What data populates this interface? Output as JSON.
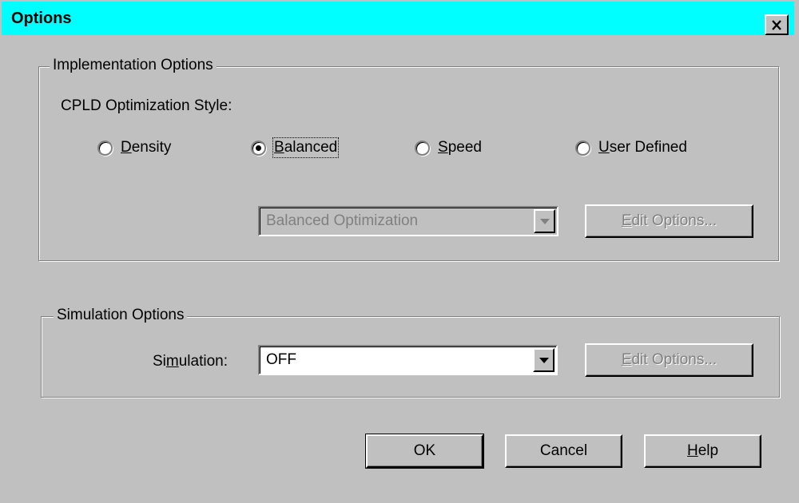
{
  "window": {
    "title": "Options",
    "close_icon": "close-x-icon"
  },
  "implementation": {
    "legend": "Implementation Options",
    "style_label": "CPLD Optimization Style:",
    "radios": [
      {
        "label": "Density",
        "mnemonic": "D",
        "rest": "ensity",
        "selected": false
      },
      {
        "label": "Balanced",
        "mnemonic": "B",
        "rest": "alanced",
        "selected": true
      },
      {
        "label": "Speed",
        "mnemonic": "S",
        "rest": "peed",
        "selected": false
      },
      {
        "label": "User Defined",
        "mnemonic": "U",
        "rest": "ser Defined",
        "selected": false
      }
    ],
    "combo_value": "Balanced Optimization",
    "combo_enabled": false,
    "edit_button": {
      "label": "Edit Options...",
      "mnemonic": "E",
      "rest": "dit Options...",
      "enabled": false
    }
  },
  "simulation": {
    "legend": "Simulation Options",
    "label": "Simulation:",
    "label_pre": "Si",
    "label_mnemonic": "m",
    "label_post": "ulation:",
    "combo_value": "OFF",
    "combo_enabled": true,
    "edit_button": {
      "label": "Edit Options...",
      "mnemonic": "E",
      "rest": "dit Options...",
      "enabled": false
    }
  },
  "buttons": {
    "ok": "OK",
    "cancel": "Cancel",
    "help": "Help",
    "help_mnemonic": "H",
    "help_rest": "elp"
  }
}
